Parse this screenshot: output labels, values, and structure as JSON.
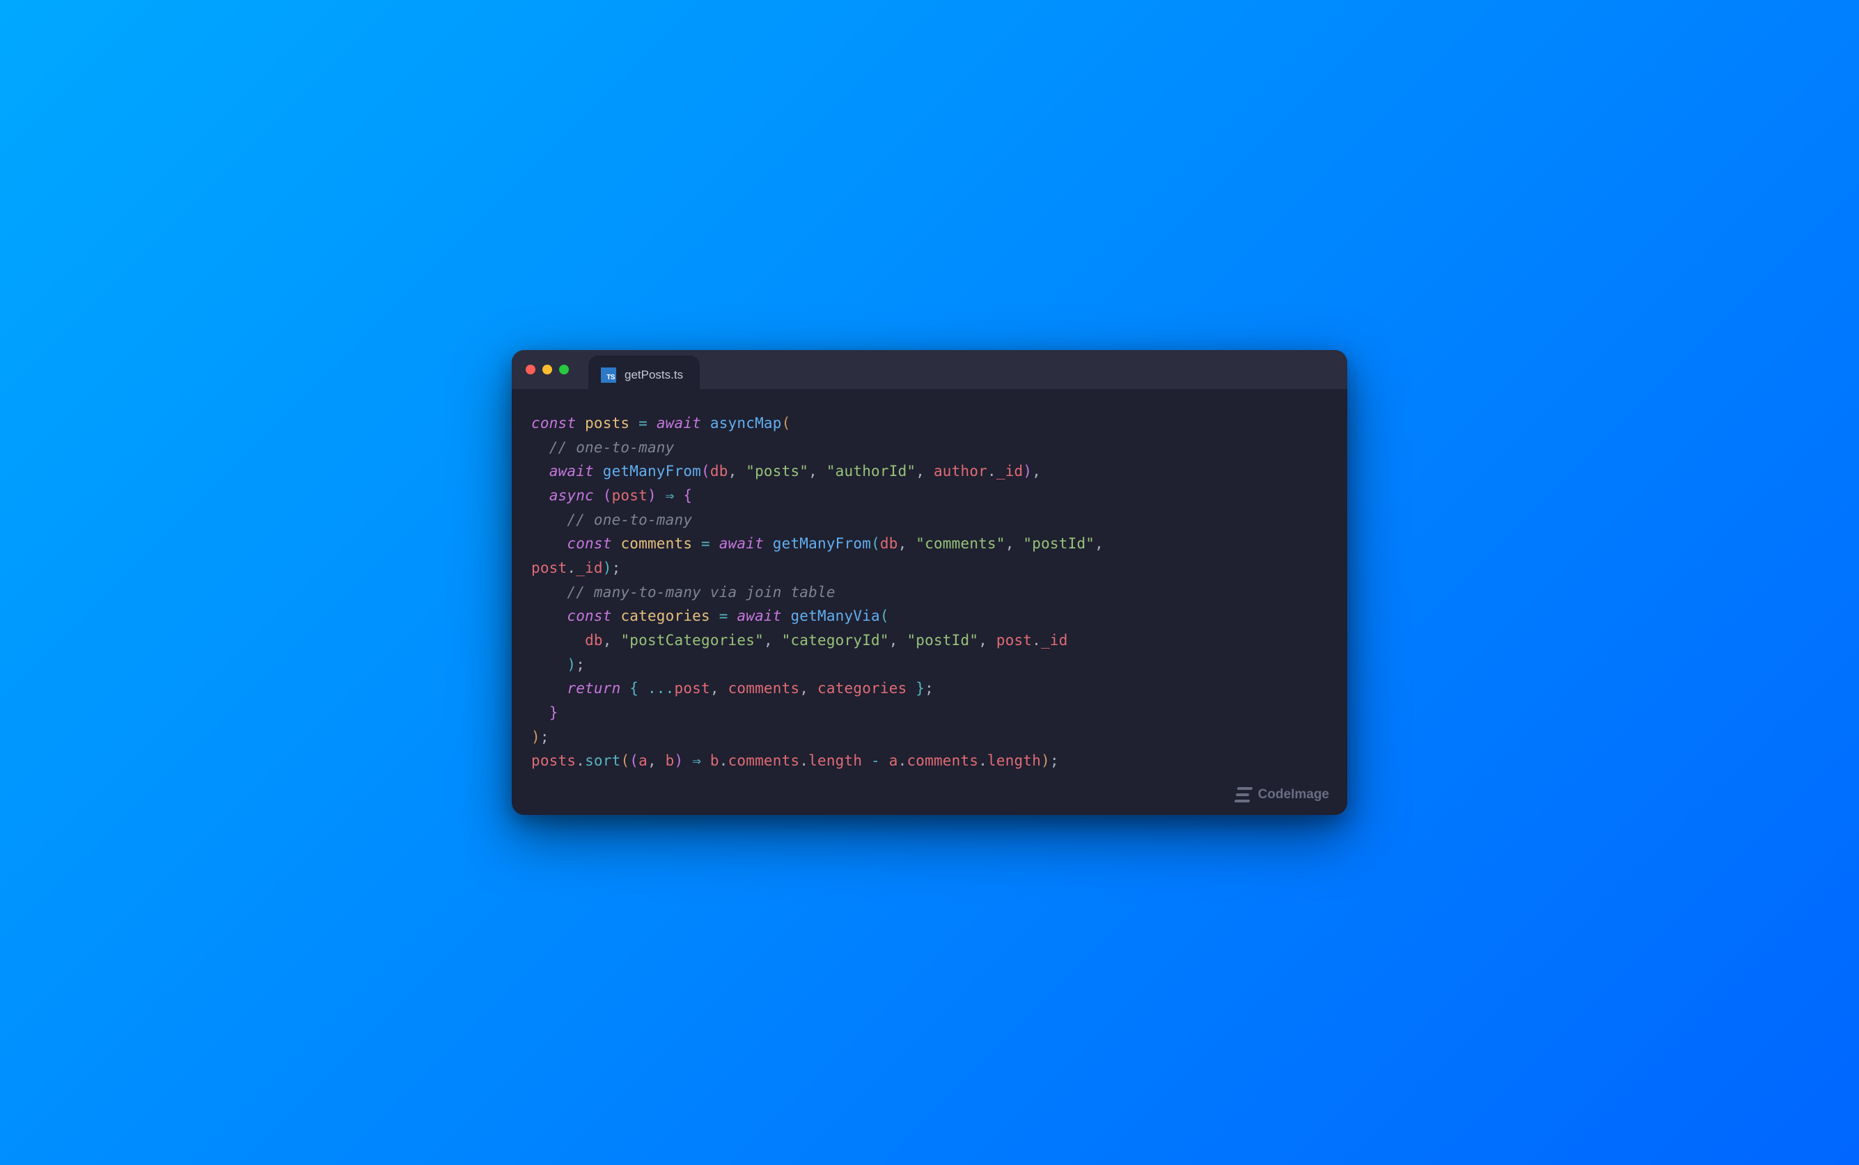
{
  "tab": {
    "badge": "TS",
    "filename": "getPosts.ts"
  },
  "watermark": "CodeImage",
  "code": {
    "l1_const": "const",
    "l1_posts": "posts",
    "l1_eq": " = ",
    "l1_await": "await",
    "l1_asyncMap": "asyncMap",
    "l2_cmt": "// one-to-many",
    "l3_await": "await",
    "l3_fn": "getManyFrom",
    "l3_db": "db",
    "l3_s1": "\"posts\"",
    "l3_s2": "\"authorId\"",
    "l3_author": "author",
    "l3_id": "_id",
    "l4_async": "async",
    "l4_post": "post",
    "l4_arrow": "⇒",
    "l5_cmt": "// one-to-many",
    "l6_const": "const",
    "l6_comments": "comments",
    "l6_await": "await",
    "l6_fn": "getManyFrom",
    "l6_db": "db",
    "l6_s1": "\"comments\"",
    "l6_s2": "\"postId\"",
    "l7_post": "post",
    "l7_id": "_id",
    "l8_cmt": "// many-to-many via join table",
    "l9_const": "const",
    "l9_categories": "categories",
    "l9_await": "await",
    "l9_fn": "getManyVia",
    "l10_db": "db",
    "l10_s1": "\"postCategories\"",
    "l10_s2": "\"categoryId\"",
    "l10_s3": "\"postId\"",
    "l10_post": "post",
    "l10_id": "_id",
    "l12_return": "return",
    "l12_spread": "...",
    "l12_post": "post",
    "l12_comments": "comments",
    "l12_categories": "categories",
    "l15_posts": "posts",
    "l15_sort": "sort",
    "l15_a": "a",
    "l15_b": "b",
    "l15_arrow": "⇒",
    "l15_b2": "b",
    "l15_comments": "comments",
    "l15_length1": "length",
    "l15_minus": " - ",
    "l15_a2": "a",
    "l15_comments2": "comments",
    "l15_length2": "length"
  }
}
